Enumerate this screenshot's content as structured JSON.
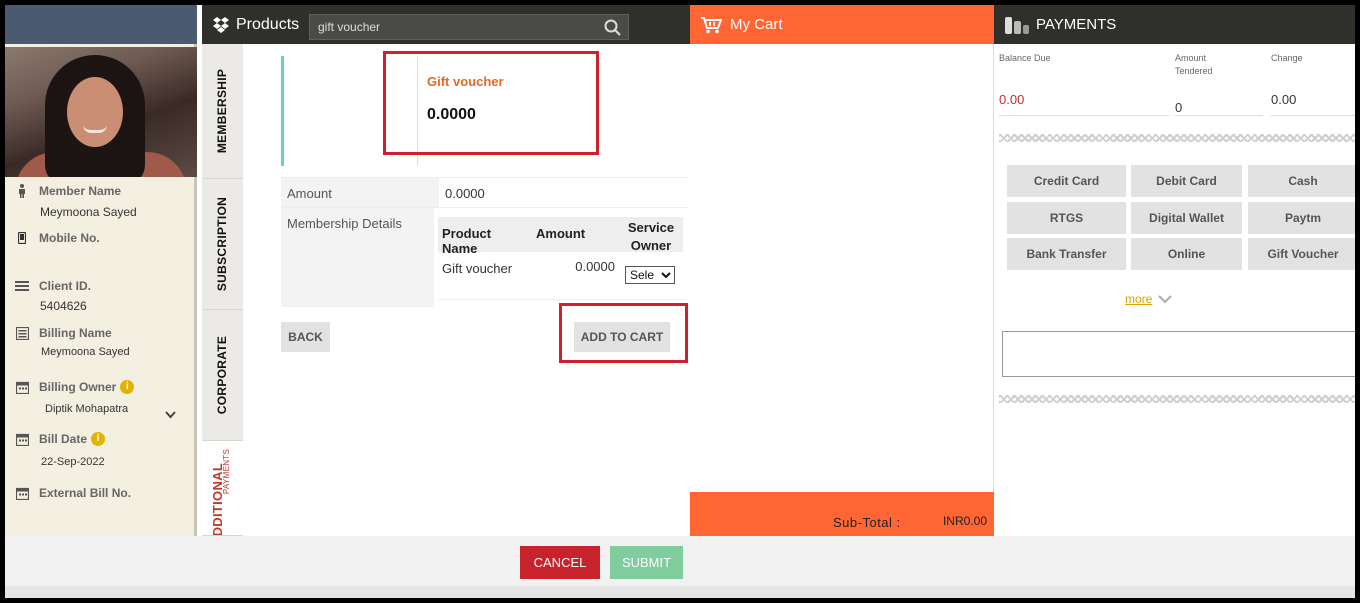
{
  "member": {
    "name_label": "Member Name",
    "name": "Meymoona Sayed",
    "mobile_label": "Mobile No.",
    "client_id_label": "Client ID.",
    "client_id": "5404626",
    "billing_name_label": "Billing Name",
    "billing_name": "Meymoona  Sayed",
    "billing_owner_label": "Billing Owner",
    "billing_owner": "Diptik Mohapatra",
    "bill_date_label": "Bill Date",
    "bill_date": "22-Sep-2022",
    "external_bill_label": "External Bill No.",
    "info_glyph": "i"
  },
  "products": {
    "title": "Products",
    "search_value": "gift voucher",
    "icon": "dropbox-icon"
  },
  "tabs": {
    "membership": "MEMBERSHIP",
    "subscription": "SUBSCRIPTION",
    "corporate": "CORPORATE",
    "additional": "ADDITIONAL",
    "payments_sub": "PAYMENTS"
  },
  "voucher": {
    "name": "Gift voucher",
    "price": "0.0000"
  },
  "details": {
    "amount_label": "Amount",
    "amount_value": "0.0000",
    "membership_label": "Membership Details",
    "col_product": "Product Name",
    "col_amount": "Amount",
    "col_owner": "Service Owner",
    "row_product": "Gift voucher",
    "row_amount": "0.0000",
    "row_select": "Sele"
  },
  "actions": {
    "back": "BACK",
    "add_to_cart": "ADD TO CART"
  },
  "cart": {
    "title": "My Cart",
    "subtotal_label": "Sub-Total :",
    "subtotal_value": "INR0.00"
  },
  "payments": {
    "title": "PAYMENTS",
    "balance_label": "Balance Due",
    "balance_value": "0.00",
    "tendered_label": "Amount Tendered",
    "tendered_value": "0",
    "change_label": "Change",
    "change_value": "0.00",
    "methods": [
      "Credit Card",
      "Debit Card",
      "Cash",
      "RTGS",
      "Digital Wallet",
      "Paytm",
      "Bank Transfer",
      "Online",
      "Gift Voucher"
    ],
    "more": "more"
  },
  "footer": {
    "cancel": "CANCEL",
    "submit": "SUBMIT"
  },
  "colors": {
    "accent_orange": "#ff6633",
    "cancel_red": "#c8232c",
    "submit_green": "#7fcc9c",
    "header_dark": "#2f2f2c",
    "balance_red": "#c0302a",
    "highlight_red": "#d0202a"
  }
}
